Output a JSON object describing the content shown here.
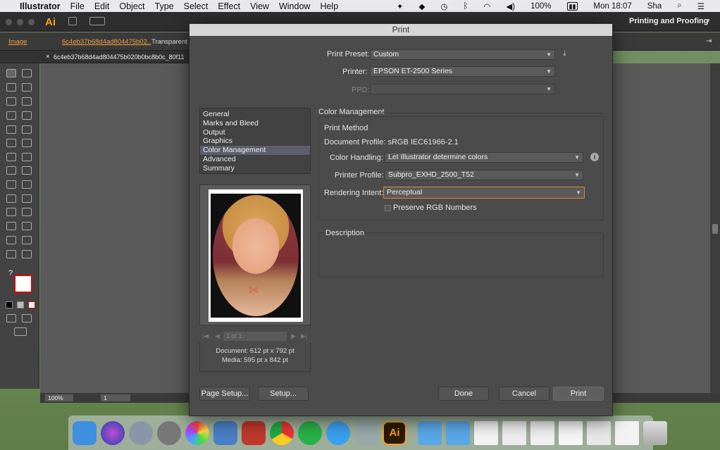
{
  "menubar": {
    "app_name": "Illustrator",
    "items": [
      "File",
      "Edit",
      "Object",
      "Type",
      "Select",
      "Effect",
      "View",
      "Window",
      "Help"
    ],
    "battery": "100%",
    "datetime": "Mon 18:07",
    "user": "Sha"
  },
  "app": {
    "logo": "Ai",
    "workspace": "Printing and Proofing",
    "control_bar": {
      "image_label": "Image",
      "link_name": "6c4eb37b68d4ad804475b02..",
      "transparent": "Transparent R"
    },
    "doc_tab": "6c4eb37b68d4ad804475b020b0bc8b0c_80f11",
    "zoom": "100%",
    "artboard": "1"
  },
  "dialog": {
    "title": "Print",
    "print_preset_label": "Print Preset:",
    "print_preset_value": "Custom",
    "printer_label": "Printer:",
    "printer_value": "EPSON ET-2500 Series",
    "ppd_label": "PPD:",
    "nav_items": [
      "General",
      "Marks and Bleed",
      "Output",
      "Graphics",
      "Color Management",
      "Advanced",
      "Summary"
    ],
    "nav_selected": "Color Management",
    "section_title": "Color Management",
    "print_method_title": "Print Method",
    "document_profile": "Document Profile: sRGB IEC61966-2.1",
    "color_handling_label": "Color Handling:",
    "color_handling_value": "Let Illustrator determine colors",
    "printer_profile_label": "Printer Profile:",
    "printer_profile_value": "Subpro_EXHD_2500_T52",
    "rendering_intent_label": "Rendering Intent:",
    "rendering_intent_value": "Perceptual",
    "preserve_rgb_label": "Preserve RGB Numbers",
    "description_title": "Description",
    "page_indicator": "1 of 1",
    "document_size": "Document: 612 pt x 792 pt",
    "media_size": "Media: 595 pt x 842 pt",
    "buttons": {
      "page_setup": "Page Setup...",
      "setup": "Setup...",
      "done": "Done",
      "cancel": "Cancel",
      "print": "Print"
    }
  },
  "colors": {
    "accent": "#e08a3a",
    "ai_orange": "#f7a21b",
    "selection": "#5d5f6e"
  }
}
